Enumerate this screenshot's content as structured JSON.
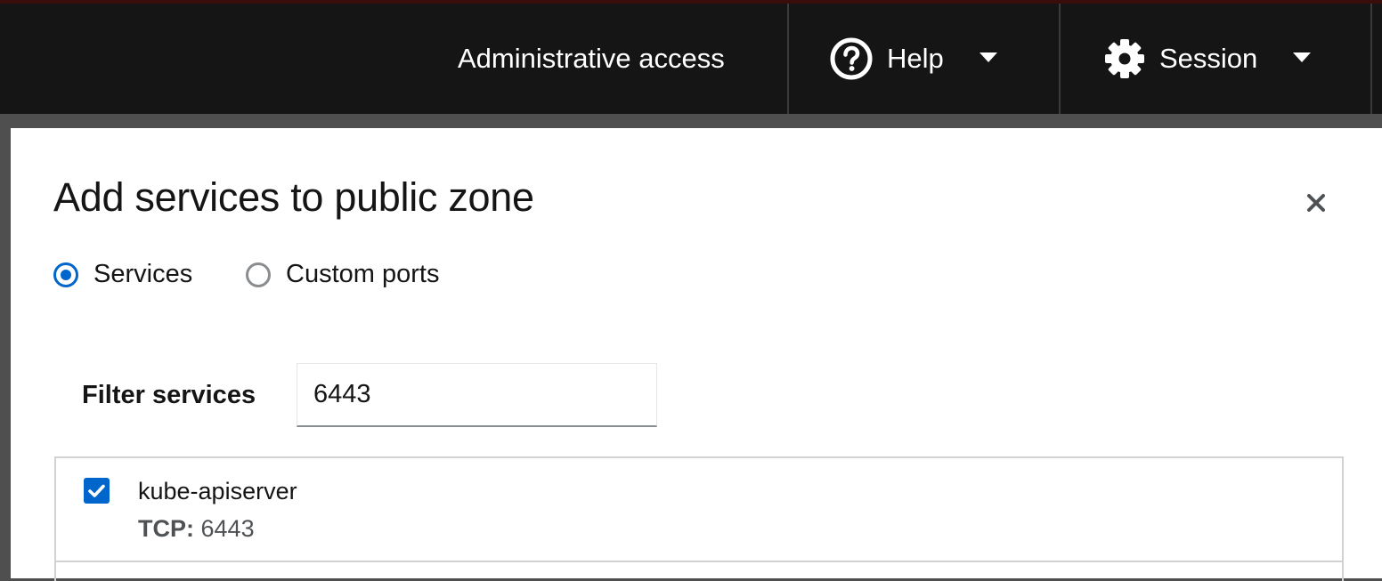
{
  "masthead": {
    "admin_access": "Administrative access",
    "help_label": "Help",
    "session_label": "Session",
    "help_icon": "help-circle-icon",
    "session_icon": "gear-icon",
    "caret_icon": "caret-down-icon"
  },
  "modal": {
    "title": "Add services to public zone",
    "close_icon": "close-icon",
    "radio_options": [
      {
        "label": "Services",
        "checked": true
      },
      {
        "label": "Custom ports",
        "checked": false
      }
    ],
    "filter": {
      "label": "Filter services",
      "value": "6443"
    },
    "services": [
      {
        "name": "kube-apiserver",
        "checked": true,
        "protocol": "TCP:",
        "port": "6443"
      }
    ]
  },
  "colors": {
    "masthead_bg": "#151515",
    "accent": "#0066cc",
    "backdrop": "#4f4f4f"
  }
}
